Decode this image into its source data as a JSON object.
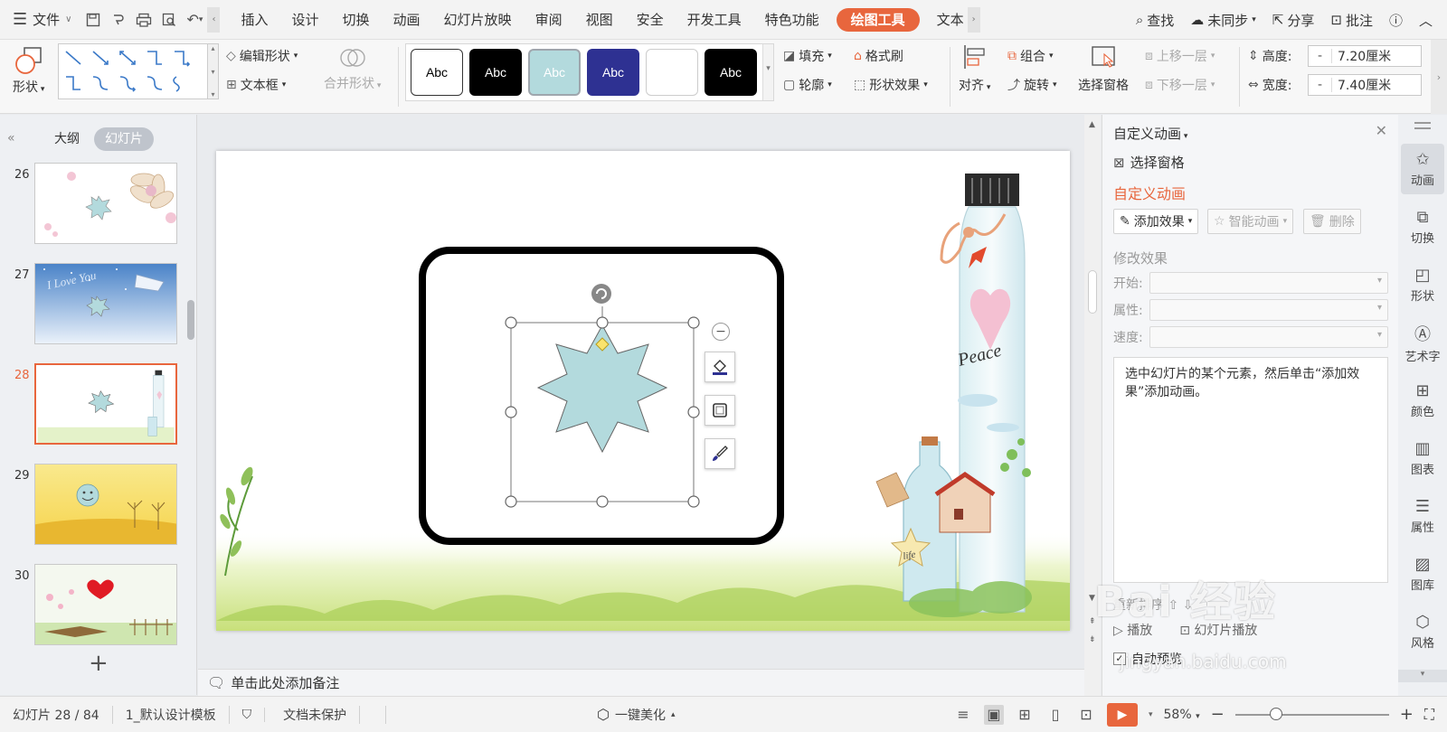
{
  "menubar": {
    "file_label": "文件",
    "tabs": [
      "插入",
      "设计",
      "切换",
      "动画",
      "幻灯片放映",
      "审阅",
      "视图",
      "安全",
      "开发工具",
      "特色功能",
      "绘图工具",
      "文本"
    ],
    "active_tab": "绘图工具",
    "search": "查找",
    "sync": "未同步",
    "share": "分享",
    "comment": "批注"
  },
  "ribbon": {
    "shape": "形状",
    "edit_shape": "编辑形状",
    "textbox": "文本框",
    "merge_shape": "合并形状",
    "style_label": "Abc",
    "fill": "填充",
    "format_painter": "格式刷",
    "outline": "轮廓",
    "shape_effects": "形状效果",
    "align": "对齐",
    "group": "组合",
    "rotate": "旋转",
    "selection_pane": "选择窗格",
    "bring_forward": "上移一层",
    "send_backward": "下移一层",
    "height_label": "高度:",
    "height_value": "7.20厘米",
    "width_label": "宽度:",
    "width_value": "7.40厘米",
    "size_minus": "-"
  },
  "leftpanel": {
    "tab_outline": "大纲",
    "tab_slides": "幻灯片",
    "slides": [
      {
        "num": "26"
      },
      {
        "num": "27"
      },
      {
        "num": "28"
      },
      {
        "num": "29"
      },
      {
        "num": "30"
      }
    ],
    "selected": "28",
    "thumb_text_27": "I Love You"
  },
  "slide": {
    "bottle_text": "Peace",
    "star_text": "life"
  },
  "notes": {
    "placeholder": "单击此处添加备注"
  },
  "animpanel": {
    "title": "自定义动画",
    "selection_pane": "选择窗格",
    "section_title": "自定义动画",
    "add_effect": "添加效果",
    "smart_anim": "智能动画",
    "delete": "删除",
    "modify_effect": "修改效果",
    "start": "开始:",
    "property": "属性:",
    "speed": "速度:",
    "hint": "选中幻灯片的某个元素，然后单击“添加效果”添加动画。",
    "reorder": "重新排序",
    "play": "播放",
    "slideshow": "幻灯片播放",
    "auto_preview": "自动预览"
  },
  "sidebar": {
    "items": [
      "动画",
      "切换",
      "形状",
      "艺术字",
      "颜色",
      "图表",
      "属性",
      "图库",
      "风格"
    ]
  },
  "statusbar": {
    "slide_info": "幻灯片 28 / 84",
    "template": "1_默认设计模板",
    "protection": "文档未保护",
    "beautify": "一键美化",
    "zoom": "58%"
  },
  "watermark": {
    "text": "Bai 经验",
    "url": "jingyan.baidu.com"
  },
  "colors": {
    "accent": "#e8663d",
    "star_fill": "#b3dadd",
    "style_dark_blue": "#2e3192"
  }
}
